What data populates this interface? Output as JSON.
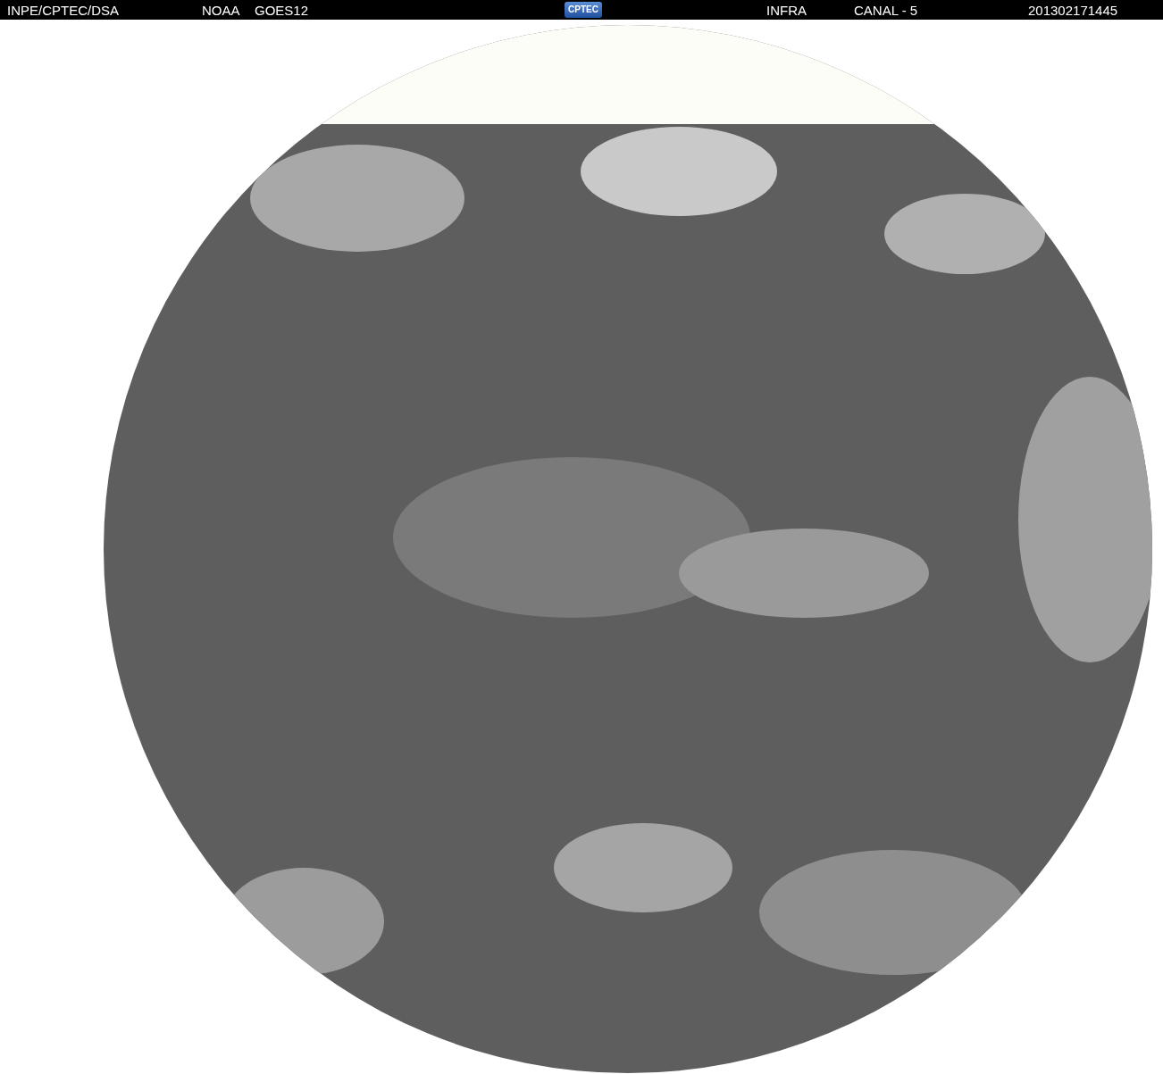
{
  "header": {
    "source": "INPE/CPTEC/DSA",
    "agency": "NOAA",
    "satellite": "GOES12",
    "logo": "CPTEC",
    "channel_type": "INFRA",
    "channel": "CANAL - 5",
    "timestamp": "201302171445"
  }
}
